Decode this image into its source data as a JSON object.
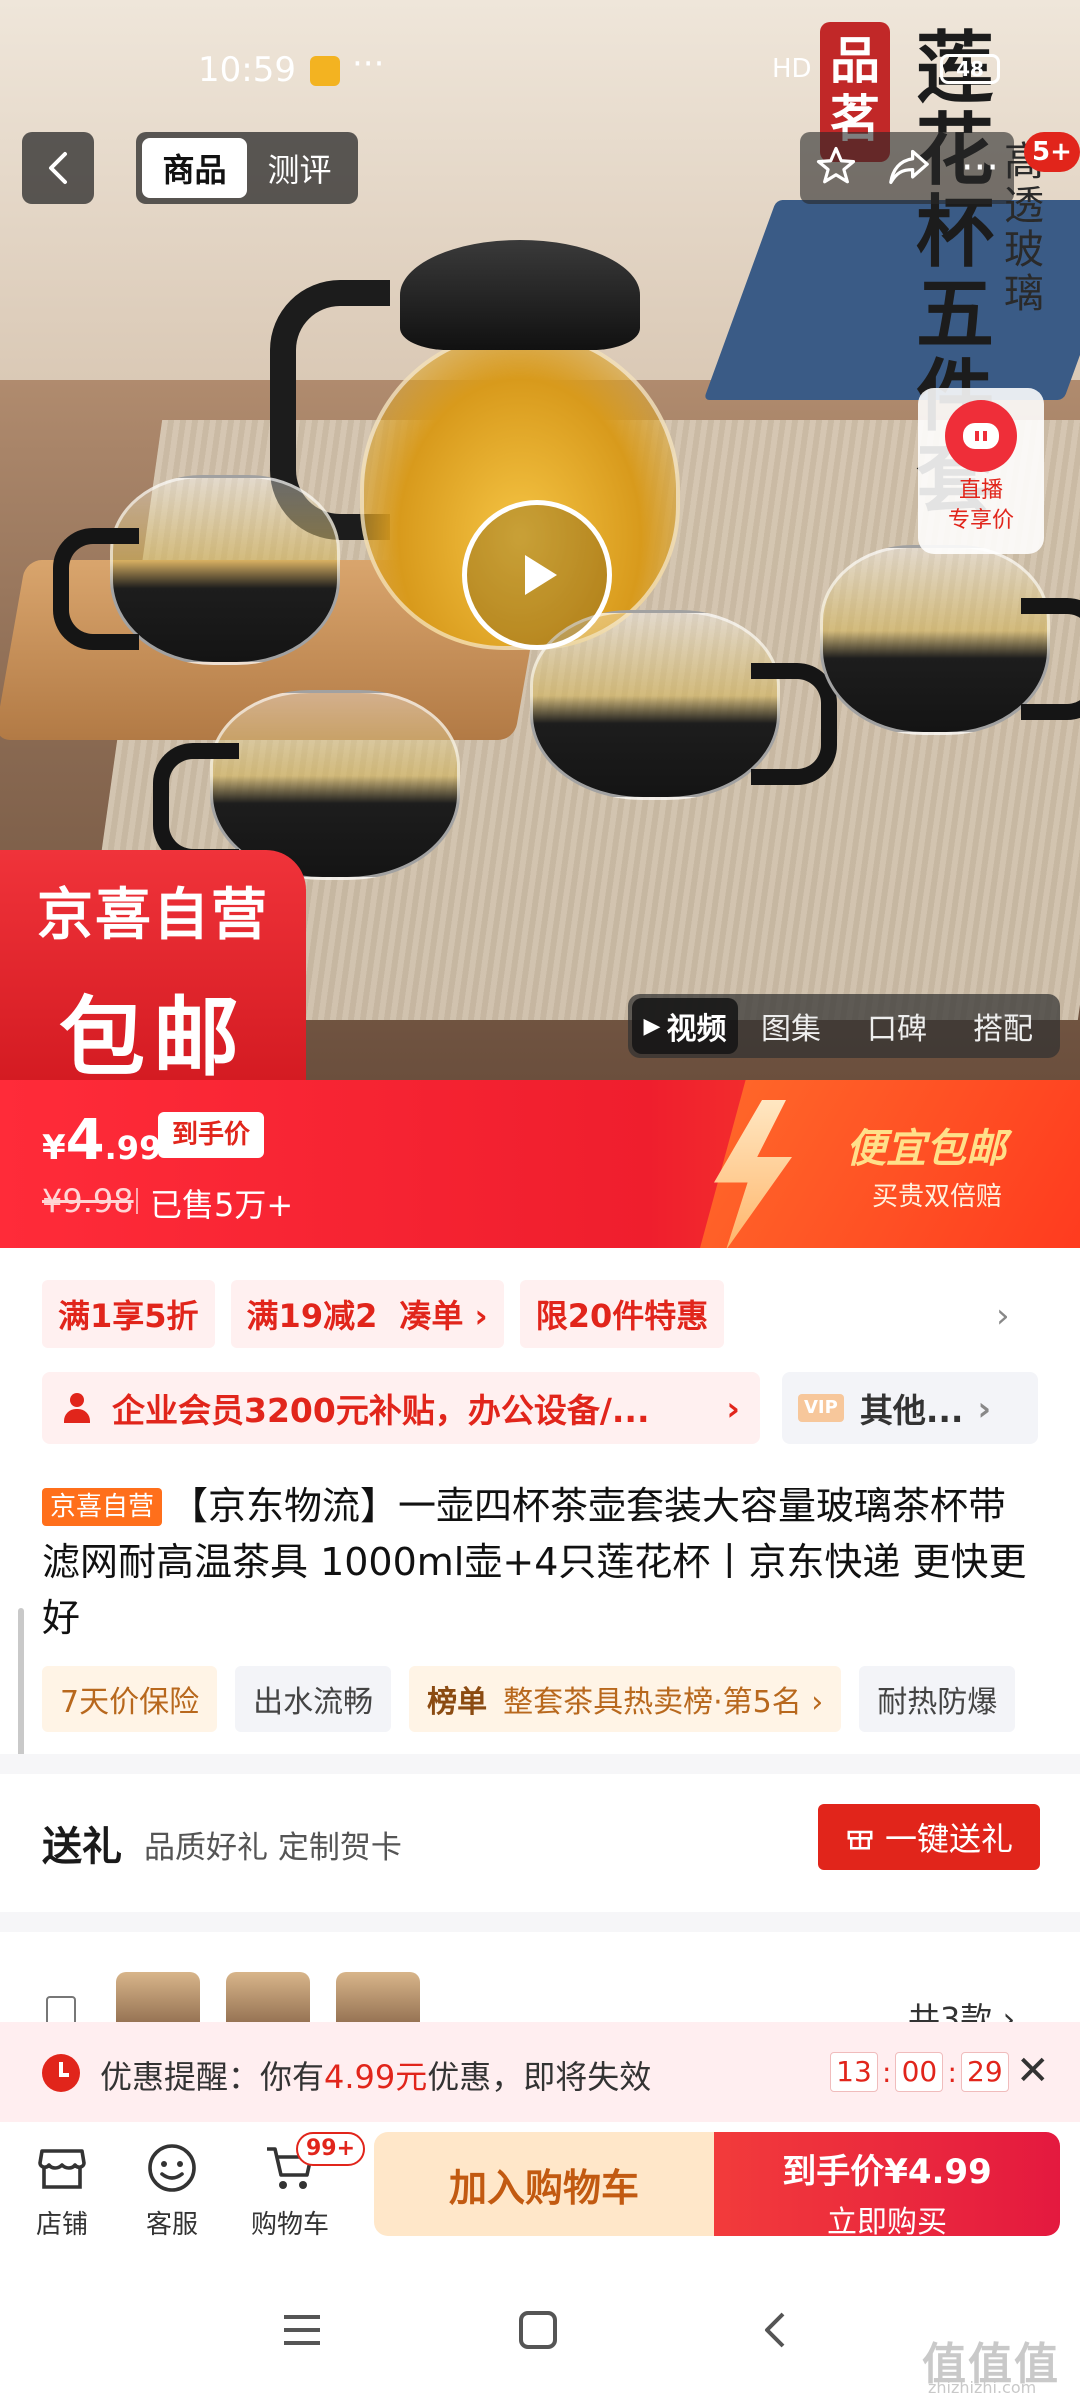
{
  "status_bar": {
    "time": "10:59",
    "dots": "···",
    "signal": "HD",
    "battery": "48"
  },
  "nav": {
    "tabs": [
      {
        "label": "商品",
        "active": true
      },
      {
        "label": "测评",
        "active": false
      }
    ],
    "badge": "5+"
  },
  "hero": {
    "title_vertical": "莲花杯五件套",
    "subtitle_vertical": "高透玻璃",
    "seal": "品茗",
    "live": {
      "line1": "直播",
      "line2": "专享价"
    },
    "promo_tag": {
      "line1": "京喜自营",
      "line2": "包邮"
    },
    "media_tabs": [
      {
        "label": "视频",
        "active": true
      },
      {
        "label": "图集"
      },
      {
        "label": "口碑"
      },
      {
        "label": "搭配"
      }
    ]
  },
  "price": {
    "symbol": "¥",
    "integer": "4",
    "decimal": ".99",
    "chip": "到手价",
    "original": "¥9.98",
    "sold": "已售5万+",
    "slogan": "便宜包邮",
    "slogan_sub": "买贵双倍赔"
  },
  "coupons": {
    "row1": [
      "满1享5折",
      "满19减2",
      "凑单 ›",
      "限20件特惠"
    ],
    "enterprise": "企业会员3200元补贴，办公设备/...",
    "other": "其他...",
    "vip": "VIP"
  },
  "product": {
    "tag": "京喜自营",
    "title": "【京东物流】一壶四杯茶壶套装大容量玻璃茶杯带滤网耐高温茶具 1000ml壶+4只莲花杯丨京东快递 更快更好",
    "features": [
      "7天价保险",
      "出水流畅"
    ],
    "rank_label": "榜单",
    "rank_text": "整套茶具热卖榜·第5名 ›",
    "feature_more": "耐热防爆"
  },
  "gift": {
    "title": "送礼",
    "subtitle": "品质好礼 定制贺卡",
    "button": "一键送礼"
  },
  "thumbs": {
    "count": "共3款 ›"
  },
  "reminder": {
    "prefix": "优惠提醒：你有",
    "amount": "4.99元",
    "suffix": "优惠，即将失效",
    "h": "13",
    "m": "00",
    "s": "29"
  },
  "bottom": {
    "shop": "店铺",
    "service": "客服",
    "cart": "购物车",
    "cart_badge": "99+",
    "add_cart": "加入购物车",
    "buy_line1": "到手价¥4.99",
    "buy_line2": "立即购买"
  },
  "watermark": {
    "logo": "值值值",
    "url": "zhizhizhi.com"
  },
  "colors": {
    "accent": "#e1251b",
    "cart_btn": "#ffe7c9",
    "price_banner": "#ff2b39"
  }
}
